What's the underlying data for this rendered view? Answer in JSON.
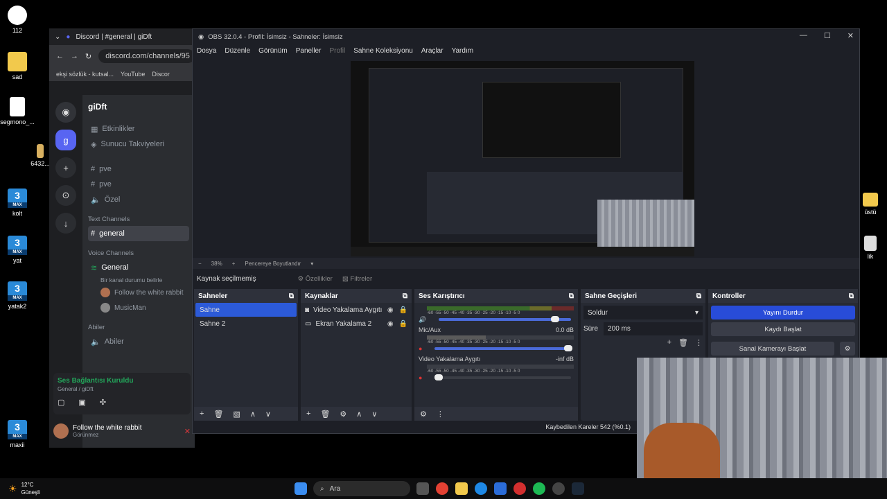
{
  "desktop": {
    "icons": [
      {
        "label": "112"
      },
      {
        "label": "sad"
      },
      {
        "label": "segmono_..."
      },
      {
        "label": "6432..."
      },
      {
        "label": "kolt"
      },
      {
        "label": "yat"
      },
      {
        "label": "yatak2"
      },
      {
        "label": "maxii"
      }
    ],
    "right_icons": [
      {
        "label": "üstü"
      },
      {
        "label": "lik"
      }
    ]
  },
  "discord": {
    "tab_title": "Discord | #general | giDft",
    "url": "discord.com/channels/95",
    "bookmarks": [
      "ekşi sözlük - kutsal...",
      "YouTube",
      "Discor"
    ],
    "server_name": "giDft",
    "channels_top": [
      "Etkinlikler",
      "Sunucu Takviyeleri"
    ],
    "channels_list": [
      "pve",
      "pve",
      "Özel"
    ],
    "text_category": "Text Channels",
    "selected_channel": "general",
    "voice_category": "Voice Channels",
    "voice_channel": "General",
    "voice_status": "Bir kanal durumu belirle",
    "voice_users": [
      "Follow the white rabbit",
      "MusicMan"
    ],
    "abiler_category": "Abiler",
    "abiler_channel": "Abiler",
    "connection_status": "Ses Bağlantısı Kuruldu",
    "connection_sub": "General / giDft",
    "username": "Follow the white rabbit",
    "user_status": "Görünmez"
  },
  "obs": {
    "title": "OBS 32.0.4 - Profil: İsimsiz - Sahneler: İsimsiz",
    "menu": [
      "Dosya",
      "Düzenle",
      "Görünüm",
      "Paneller",
      "Profil",
      "Sahne Koleksiyonu",
      "Araçlar",
      "Yardım"
    ],
    "zoom": "38%",
    "fit_label": "Pencereye Boyutlandır",
    "no_source": "Kaynak seçilmemiş",
    "properties": "Özellikler",
    "filters": "Filtreler",
    "scenes_title": "Sahneler",
    "scenes": [
      "Sahne",
      "Sahne 2"
    ],
    "sources_title": "Kaynaklar",
    "sources": [
      "Video Yakalama Aygıtı",
      "Ekran Yakalama 2"
    ],
    "mixer_title": "Ses Karıştırıcı",
    "mixer_tracks": [
      {
        "name": "",
        "db": "",
        "level": 0.88
      },
      {
        "name": "Mic/Aux",
        "db": "0.0 dB",
        "level": 0.98
      },
      {
        "name": "Video Yakalama Aygıtı",
        "db": "-inf dB",
        "level": 0.02
      }
    ],
    "meter_ticks": "-60  -55  -50  -45  -40  -35  -30  -25  -20  -15  -10  -5  0",
    "transitions_title": "Sahne Geçişleri",
    "transition": "Soldur",
    "duration_label": "Süre",
    "duration": "200 ms",
    "controls_title": "Kontroller",
    "controls": [
      "Yayını Durdur",
      "Kaydı Başlat",
      "Sanal Kamerayı Başlat"
    ],
    "status": "Kaybedilen Kareler 542 (%0.1)"
  },
  "taskbar": {
    "temp": "12°C",
    "weather": "Güneşli",
    "search": "Ara"
  },
  "colors": {
    "obs_accent": "#2c5ad8",
    "discord_bg": "#2b2d31",
    "connected_green": "#23a55a"
  }
}
